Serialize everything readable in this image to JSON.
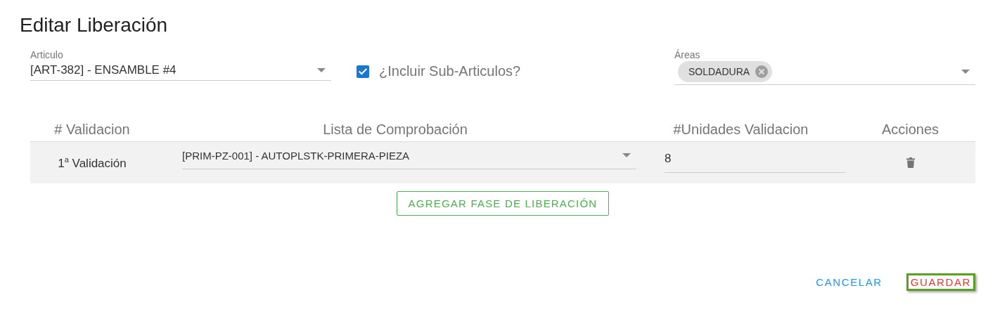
{
  "dialog": {
    "title": "Editar Liberación"
  },
  "article_field": {
    "label": "Articulo",
    "value": "[ART-382] - ENSAMBLE #4"
  },
  "include_sub_articles": {
    "label": "¿Incluir Sub-Articulos?",
    "checked": true
  },
  "areas_field": {
    "label": "Áreas",
    "chips": [
      "SOLDADURA"
    ]
  },
  "table": {
    "columns": [
      "# Validacion",
      "Lista de Comprobación",
      "#Unidades Validacion",
      "Acciones"
    ],
    "rows": [
      {
        "validation": "1$^{a}$ Validación",
        "checklist": "[PRIM-PZ-001] - AUTOPLSTK-PRIMERA-PIEZA",
        "units": "8"
      }
    ]
  },
  "add_button": "AGREGAR FASE DE LIBERACIÓN",
  "buttons": [
    {
      "label": "CANCELAR",
      "kind": "cancel",
      "focused": false
    },
    {
      "label": "GUARDAR",
      "kind": "save",
      "focused": true
    }
  ]
}
